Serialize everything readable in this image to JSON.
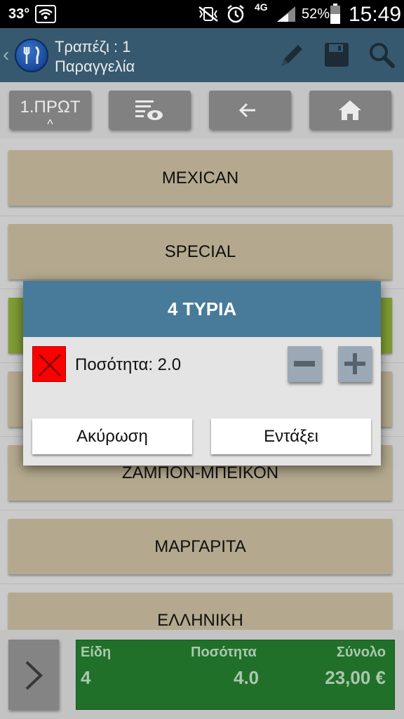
{
  "status_bar": {
    "temperature": "33°",
    "network": "4G",
    "battery": "52%",
    "time": "15:49"
  },
  "action_bar": {
    "title_line1": "Τραπέζι : 1",
    "title_line2": "Παραγγελία",
    "icons": [
      "back-arrow-icon",
      "restaurant-logo-icon",
      "pencil-icon",
      "save-icon",
      "search-icon"
    ]
  },
  "toolbar": {
    "category_label": "1.ΠΡΩΤ",
    "category_caret": "^",
    "icons": [
      "view-list-icon",
      "back-arrow-icon",
      "home-icon"
    ]
  },
  "menu_items": [
    {
      "label": "MEXICAN"
    },
    {
      "label": "SPECIAL"
    },
    {
      "label": ""
    },
    {
      "label": ""
    },
    {
      "label": "ΖΑΜΠΟΝ-ΜΠΕΙΚΟΝ"
    },
    {
      "label": "ΜΑΡΓΑΡΙΤΑ"
    },
    {
      "label": "ΕΛΛΗΝΙΚΗ"
    }
  ],
  "summary": {
    "items_header": "Είδη",
    "quantity_header": "Ποσότητα",
    "total_header": "Σύνολο",
    "items_value": "4",
    "quantity_value": "4.0",
    "total_value": "23,00 €"
  },
  "dialog": {
    "title": "4 ΤΥΡΙΑ",
    "quantity_text": "Ποσότητα: 2.0",
    "cancel_label": "Ακύρωση",
    "ok_label": "Εντάξει"
  },
  "colors": {
    "action_bar": "#3b6179",
    "item_tan": "#c4b89b",
    "item_green": "#8dab3a",
    "dialog_header": "#477b99",
    "summary_green": "#237a2e",
    "remove_red": "#ff0000"
  }
}
